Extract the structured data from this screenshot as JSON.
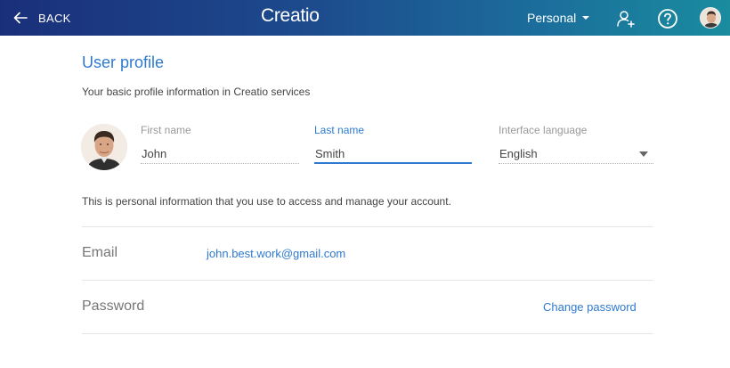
{
  "header": {
    "back_label": "BACK",
    "logo": "Creatio",
    "workspace": "Personal",
    "icons": {
      "back": "arrow-left-icon",
      "caret": "chevron-down-icon",
      "add_user": "add-user-icon",
      "help": "help-icon",
      "avatar": "user-avatar"
    }
  },
  "profile": {
    "title": "User profile",
    "subtitle": "Your basic profile information in Creatio services",
    "first_name": {
      "label": "First name",
      "value": "John"
    },
    "last_name": {
      "label": "Last name",
      "value": "Smith"
    },
    "language": {
      "label": "Interface language",
      "value": "English"
    },
    "note": "This is personal information that you use to access and manage your account."
  },
  "account": {
    "email_label": "Email",
    "email_value": "john.best.work@gmail.com",
    "password_label": "Password",
    "change_password": "Change password"
  },
  "colors": {
    "accent": "#2f7ad0",
    "header_start": "#1a2f7a",
    "header_end": "#1a8c9e"
  }
}
